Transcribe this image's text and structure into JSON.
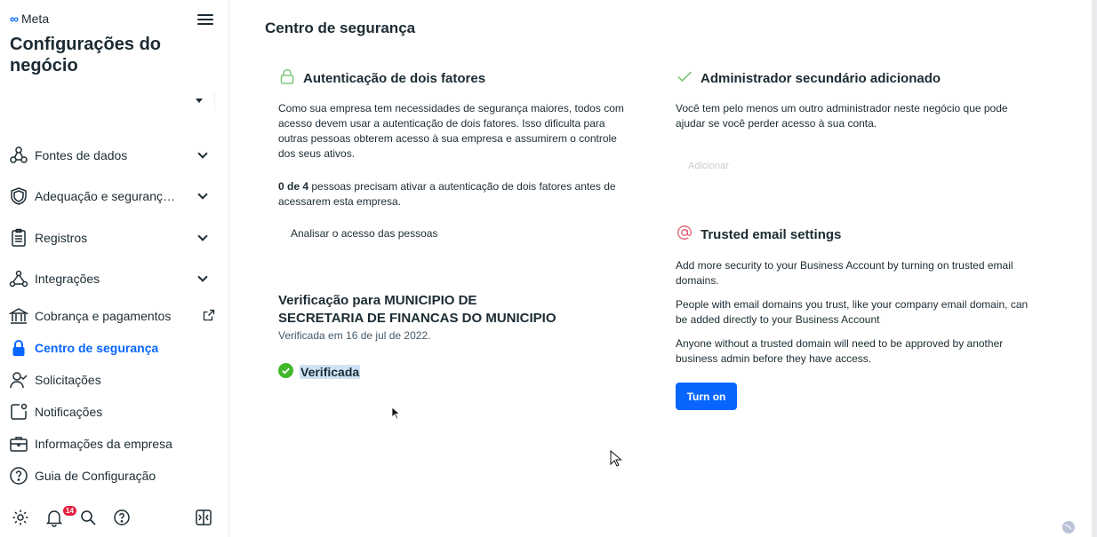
{
  "brand": {
    "name": "Meta"
  },
  "sidebar": {
    "title": "Configurações do negócio",
    "items": [
      {
        "label": "Fontes de dados",
        "icon": "data-sources-icon",
        "expandable": true
      },
      {
        "label": "Adequação e segurança ...",
        "icon": "shield-icon",
        "expandable": true
      },
      {
        "label": "Registros",
        "icon": "clipboard-icon",
        "expandable": true
      },
      {
        "label": "Integrações",
        "icon": "integrations-icon",
        "expandable": true
      },
      {
        "label": "Cobrança e pagamentos",
        "icon": "bank-icon",
        "external": true
      },
      {
        "label": "Centro de segurança",
        "icon": "lock-icon",
        "active": true
      },
      {
        "label": "Solicitações",
        "icon": "person-check-icon"
      },
      {
        "label": "Notificações",
        "icon": "notification-icon"
      },
      {
        "label": "Informações da empresa",
        "icon": "briefcase-icon"
      },
      {
        "label": "Guia de Configuração",
        "icon": "help-circle-icon"
      }
    ],
    "footer": {
      "notification_count": "14"
    }
  },
  "main": {
    "title": "Centro de segurança",
    "two_factor": {
      "title": "Autenticação de dois fatores",
      "description": "Como sua empresa tem necessidades de segurança maiores, todos com acesso devem usar a autenticação de dois fatores. Isso dificulta para outras pessoas obterem acesso à sua empresa e assumirem o controle dos seus ativos.",
      "count_bold": "0 de 4",
      "count_rest": " pessoas precisam ativar a autenticação de dois fatores antes de acessarem esta empresa.",
      "review_link": "Analisar o acesso das pessoas"
    },
    "verification": {
      "title_line1": "Verificação para MUNICIPIO DE",
      "title_line2": "SECRETARIA DE FINANCAS DO MUNICIPIO",
      "date": "Verificada em 16 de jul de 2022.",
      "status": "Verificada"
    },
    "secondary_admin": {
      "title": "Administrador secundário adicionado",
      "description": "Você tem pelo menos um outro administrador neste negócio que pode ajudar se você perder acesso à sua conta.",
      "add_label": "Adicionar"
    },
    "trusted_email": {
      "title": "Trusted email settings",
      "p1": "Add more security to your Business Account by turning on trusted email domains.",
      "p2": "People with email domains you trust, like your company email domain, can be added directly to your Business Account",
      "p3": "Anyone without a trusted domain will need to be approved by another business admin before they have access.",
      "button": "Turn on"
    }
  },
  "colors": {
    "accent": "#0866ff",
    "success": "#42b72a",
    "badge": "#e41e3f",
    "lock_green": "#7ec87a"
  }
}
